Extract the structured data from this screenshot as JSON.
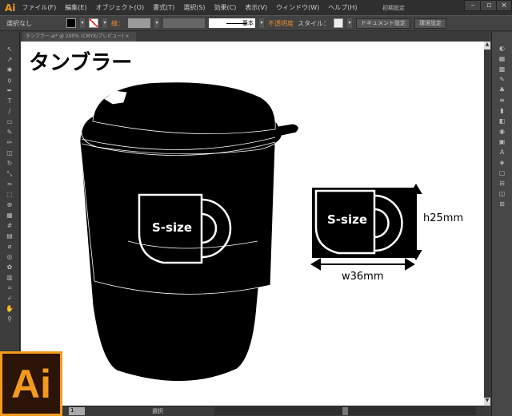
{
  "app": {
    "logo": "Ai",
    "menus": [
      "ファイル(F)",
      "編集(E)",
      "オブジェクト(O)",
      "書式(T)",
      "選択(S)",
      "効果(C)",
      "表示(V)",
      "ウィンドウ(W)",
      "ヘルプ(H)"
    ],
    "workspace": "初期設定",
    "window_buttons": [
      "–",
      "▫",
      "×"
    ]
  },
  "control": {
    "selection": "選択なし",
    "stroke_label": "線：",
    "stroke_style": "基本",
    "opacity_label": "不透明度",
    "style_label": "スタイル：",
    "doc_setup": "ドキュメント設定",
    "prefs": "環境設定"
  },
  "tab": {
    "title": "タンブラー.ai* @ 200% (CMYK/プレビュー)",
    "close": "×"
  },
  "artwork": {
    "title": "タンブラー",
    "cup_label": "S-size",
    "width_label": "w36mm",
    "height_label": "h25mm"
  },
  "status": {
    "page": "1",
    "mode": "選択"
  },
  "splash_logo": "Ai",
  "colors": {
    "accent": "#f39a1e",
    "ink": "#000000"
  }
}
